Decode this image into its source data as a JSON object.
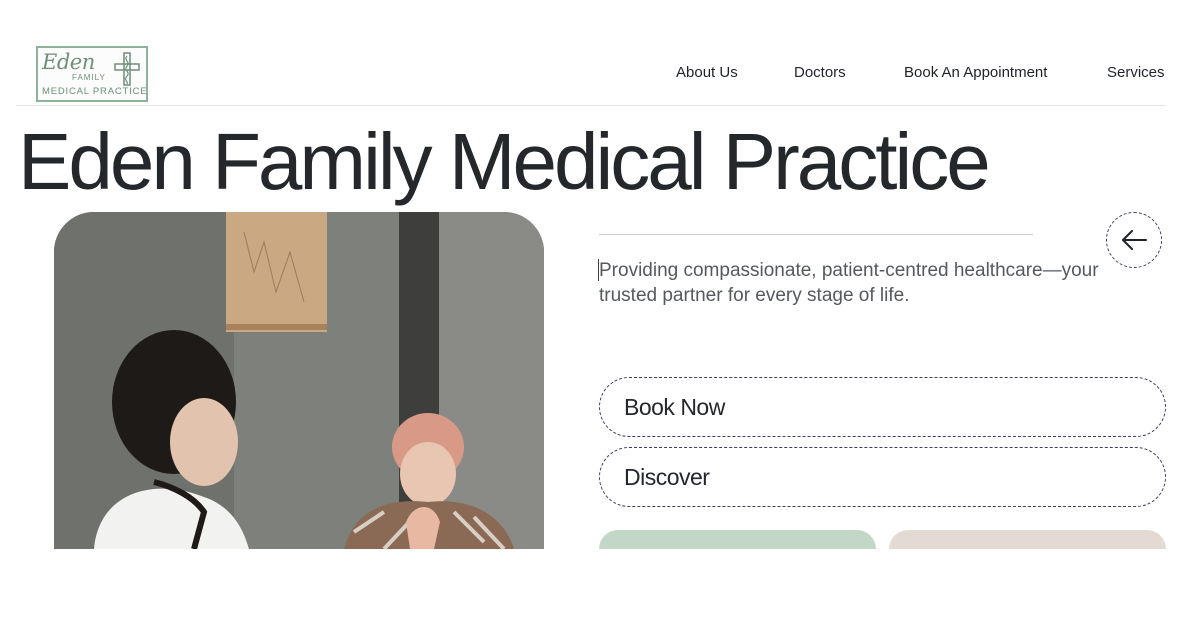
{
  "logo": {
    "script_text": "Eden",
    "family_text": "FAMILY",
    "sub_text": "MEDICAL PRACTICE",
    "brand_color": "#6e8f78"
  },
  "nav": {
    "items": [
      {
        "label": "About Us"
      },
      {
        "label": "Doctors"
      },
      {
        "label": "Book An Appointment"
      },
      {
        "label": "Services"
      }
    ]
  },
  "hero": {
    "title": "Eden Family Medical Practice",
    "tagline": "Providing compassionate, patient-centred healthcare—your trusted partner for every stage of life.",
    "back_icon": "arrow-left-icon"
  },
  "actions": {
    "book_now_label": "Book Now",
    "discover_label": "Discover"
  },
  "colors": {
    "card_green": "#c3d7c6",
    "card_beige": "#e3dad4",
    "outline": "#3b3f66"
  }
}
